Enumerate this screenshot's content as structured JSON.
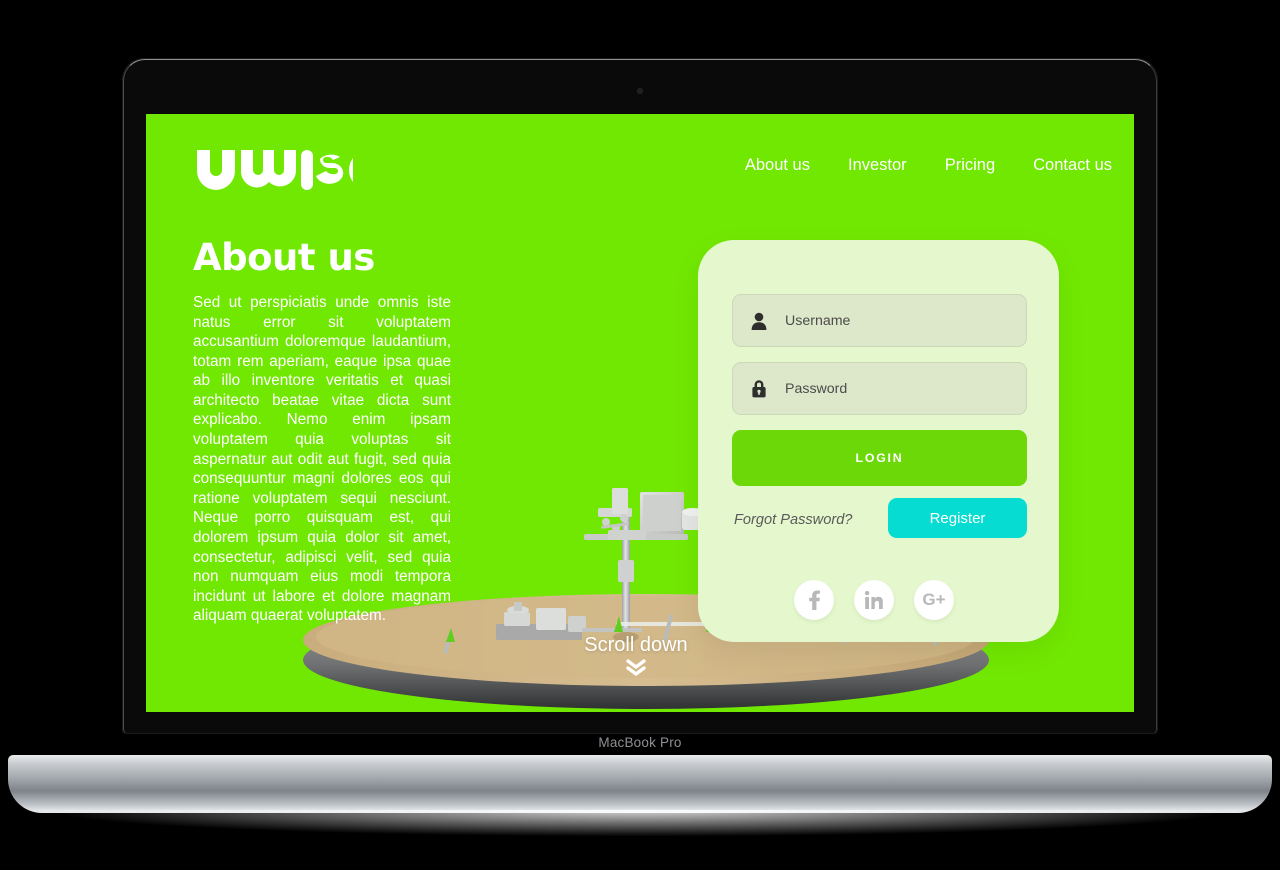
{
  "device": {
    "model_label": "MacBook Pro",
    "camera_icon": "camera-dot-icon"
  },
  "brand": {
    "logo_text": "UWISE"
  },
  "nav": {
    "items": [
      {
        "label": "About us"
      },
      {
        "label": "Investor"
      },
      {
        "label": "Pricing"
      },
      {
        "label": "Contact us"
      }
    ]
  },
  "about": {
    "title": "About us",
    "body": "Sed ut perspiciatis unde omnis iste natus error sit voluptatem accusantium doloremque laudantium, totam rem aperiam, eaque ipsa quae ab illo inventore veritatis et quasi architecto beatae vitae dicta sunt explicabo. Nemo enim ipsam voluptatem quia voluptas sit aspernatur aut odit aut fugit, sed quia consequuntur magni dolores eos qui ratione voluptatem sequi nesciunt. Neque porro quisquam est, qui dolorem ipsum quia dolor sit amet, consectetur, adipisci velit, sed quia non numquam eius modi tempora incidunt ut labore et dolore magnam aliquam quaerat voluptatem."
  },
  "scroll": {
    "label": "Scroll down",
    "chevron_icon": "chevron-double-down-icon",
    "chevron_glyph": "⌄⌄"
  },
  "login": {
    "username": {
      "placeholder": "Username",
      "value": "",
      "icon": "user-icon"
    },
    "password": {
      "placeholder": "Password",
      "value": "",
      "icon": "lock-icon"
    },
    "login_label": "LOGIN",
    "forgot_label": "Forgot Password?",
    "register_label": "Register",
    "socials": [
      {
        "name": "facebook",
        "glyph": "f"
      },
      {
        "name": "linkedin",
        "glyph": "in"
      },
      {
        "name": "googleplus",
        "glyph": "G+"
      }
    ]
  },
  "colors": {
    "background_green": "#71e802",
    "card_green": "#e5f8cd",
    "field_green": "#dde7c9",
    "login_button": "#6cd808",
    "register_button": "#06dcd2",
    "text_white": "#ffffff",
    "sand": "#cbb183",
    "device_body": "#9aa0a5"
  }
}
